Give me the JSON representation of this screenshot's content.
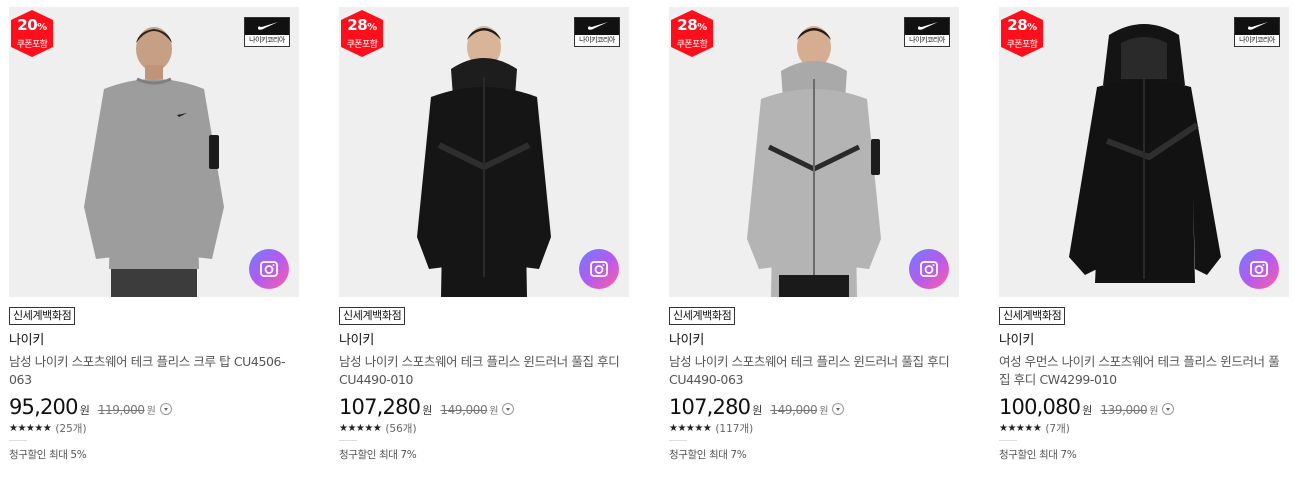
{
  "colors": {
    "badge_red": "#ff0f1c",
    "accent": "#b35bf0"
  },
  "products": [
    {
      "discount_number": "20",
      "discount_unit": "%",
      "coupon_label": "쿠폰포함",
      "logo_label": "나이키코리아",
      "store_label": "신세계백화점",
      "brand": "나이키",
      "title": "남성 나이키 스포츠웨어 테크 플리스 크루 탑 CU4506-063",
      "price": "95,200",
      "price_unit": "원",
      "original_price": "119,000",
      "original_unit": "원",
      "stars": "★★★★★",
      "reviews": "(25개)",
      "billing": "청구할인 최대 5%",
      "garment": "crew-gray",
      "icon_name": "camera-icon"
    },
    {
      "discount_number": "28",
      "discount_unit": "%",
      "coupon_label": "쿠폰포함",
      "logo_label": "나이키코리아",
      "store_label": "신세계백화점",
      "brand": "나이키",
      "title": "남성 나이키 스포츠웨어 테크 플리스 윈드러너 풀집 후디 CU4490-010",
      "price": "107,280",
      "price_unit": "원",
      "original_price": "149,000",
      "original_unit": "원",
      "stars": "★★★★★",
      "reviews": "(56개)",
      "billing": "청구할인 최대 7%",
      "garment": "hoodie-black",
      "icon_name": "camera-icon"
    },
    {
      "discount_number": "28",
      "discount_unit": "%",
      "coupon_label": "쿠폰포함",
      "logo_label": "나이키코리아",
      "store_label": "신세계백화점",
      "brand": "나이키",
      "title": "남성 나이키 스포츠웨어 테크 플리스 윈드러너 풀집 후디 CU4490-063",
      "price": "107,280",
      "price_unit": "원",
      "original_price": "149,000",
      "original_unit": "원",
      "stars": "★★★★★",
      "reviews": "(117개)",
      "billing": "청구할인 최대 7%",
      "garment": "hoodie-gray",
      "icon_name": "camera-icon"
    },
    {
      "discount_number": "28",
      "discount_unit": "%",
      "coupon_label": "쿠폰포함",
      "logo_label": "나이키코리아",
      "store_label": "신세계백화점",
      "brand": "나이키",
      "title": "여성 우먼스 나이키 스포츠웨어 테크 플리스 윈드러너 풀집 후디 CW4299-010",
      "price": "100,080",
      "price_unit": "원",
      "original_price": "139,000",
      "original_unit": "원",
      "stars": "★★★★★",
      "reviews": "(7개)",
      "billing": "청구할인 최대 7%",
      "garment": "womens-black",
      "icon_name": "camera-icon"
    }
  ]
}
